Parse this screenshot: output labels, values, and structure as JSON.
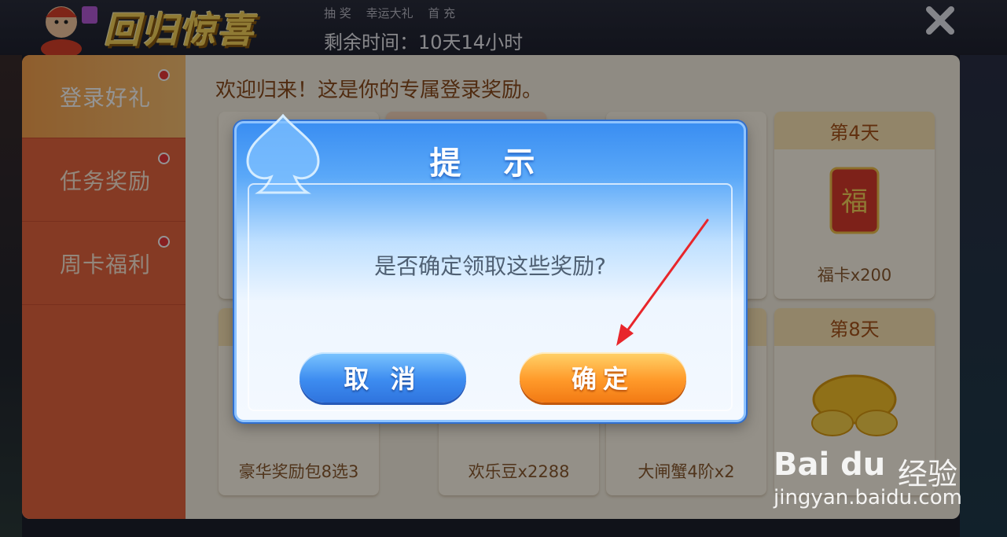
{
  "header": {
    "event_title": "回归惊喜",
    "tabs": [
      "抽 奖",
      "幸运大礼",
      "首 充"
    ],
    "remaining_time": "剩余时间：10天14小时"
  },
  "sidebar": {
    "items": [
      {
        "label": "登录好礼",
        "active": true
      },
      {
        "label": "任务奖励",
        "active": false
      },
      {
        "label": "周卡福利",
        "active": false
      }
    ]
  },
  "main": {
    "welcome": "欢迎归来！这是你的专属登录奖励。",
    "cards": [
      {
        "day": "第4天",
        "reward": "福卡x200"
      },
      {
        "day": "第8天",
        "reward": ""
      },
      {
        "day": "",
        "reward": "豪华奖励包8选3"
      },
      {
        "day": "",
        "reward": "欢乐豆x2288"
      },
      {
        "day": "",
        "reward": "大闸蟹4阶x2"
      }
    ]
  },
  "dialog": {
    "title": "提 示",
    "message": "是否确定领取这些奖励?",
    "cancel_label": "取 消",
    "confirm_label": "确定"
  },
  "watermark": {
    "logo": "Bai du",
    "text": "经验",
    "url": "jingyan.baidu.com"
  },
  "colors": {
    "menu_bg": "#e6653e",
    "dialog_blue": "#3a8ef2",
    "cancel_blue": "#3d8cf0",
    "confirm_orange": "#ff9a2a",
    "annotation_arrow": "#e8262b"
  }
}
